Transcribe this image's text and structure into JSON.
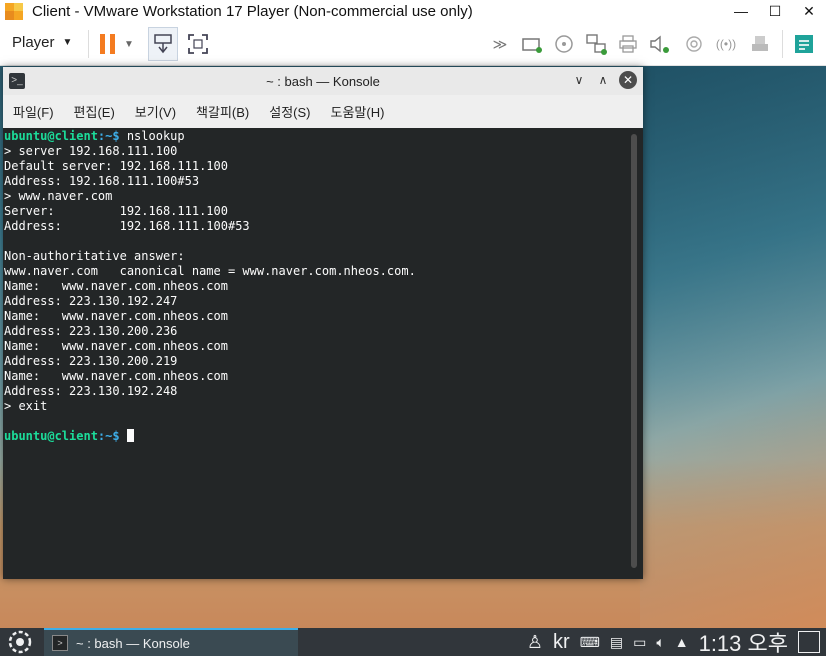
{
  "vmware": {
    "title": "Client - VMware Workstation 17 Player (Non-commercial use only)",
    "player_menu": "Player",
    "window_controls": {
      "minimize": "—",
      "maximize": "☐",
      "close": "✕"
    },
    "toolbar_icons": [
      "pause-icon",
      "send-ctrl-alt-del-icon",
      "fullscreen-icon",
      "forward-icon",
      "hard-disk-icon",
      "cd-drive-icon",
      "network-icon",
      "printer-icon",
      "sound-icon",
      "usb-icon",
      "wireless-icon",
      "printer2-icon",
      "notes-icon"
    ]
  },
  "konsole": {
    "title": "~ : bash — Konsole",
    "menu": [
      "파일(F)",
      "편집(E)",
      "보기(V)",
      "책갈피(B)",
      "설정(S)",
      "도움말(H)"
    ],
    "prompt_user": "ubuntu@client",
    "prompt_path": ":~$",
    "command": " nslookup",
    "output_lines": [
      "> server 192.168.111.100",
      "Default server: 192.168.111.100",
      "Address: 192.168.111.100#53",
      "> www.naver.com",
      "Server:         192.168.111.100",
      "Address:        192.168.111.100#53",
      "",
      "Non-authoritative answer:",
      "www.naver.com   canonical name = www.naver.com.nheos.com.",
      "Name:   www.naver.com.nheos.com",
      "Address: 223.130.192.247",
      "Name:   www.naver.com.nheos.com",
      "Address: 223.130.200.236",
      "Name:   www.naver.com.nheos.com",
      "Address: 223.130.200.219",
      "Name:   www.naver.com.nheos.com",
      "Address: 223.130.192.248",
      "> exit",
      ""
    ],
    "final_prompt_user": "ubuntu@client",
    "final_prompt_path": ":~$"
  },
  "taskbar": {
    "task_label": "~ : bash — Konsole",
    "keyboard_layout": "kr",
    "clock": "1:13 오후"
  },
  "colors": {
    "prompt_user": "#1cdc9a",
    "prompt_path": "#3daee9",
    "terminal_bg": "#232627",
    "pause_orange": "#f47b20"
  }
}
